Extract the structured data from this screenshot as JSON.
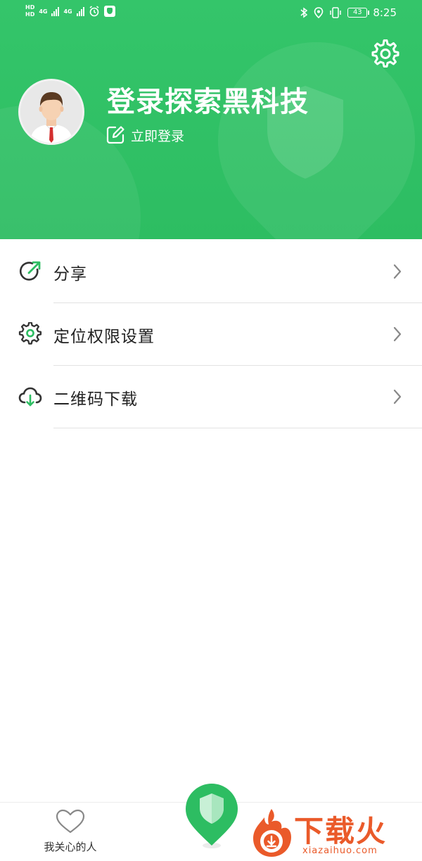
{
  "status_bar": {
    "hd_top": "HD",
    "hd_bottom": "HD",
    "sim1": "4G",
    "sim2": "4G",
    "battery": "43",
    "time": "8:25"
  },
  "header": {
    "title": "登录探索黑科技",
    "login_label": "立即登录",
    "background_color": "#2dbd62"
  },
  "menu": {
    "items": [
      {
        "label": "分享",
        "icon": "share-icon"
      },
      {
        "label": "定位权限设置",
        "icon": "gear-icon"
      },
      {
        "label": "二维码下载",
        "icon": "cloud-download-icon"
      }
    ]
  },
  "tabbar": {
    "care_label": "我关心的人",
    "care_icon": "heart-icon",
    "center_icon": "shield-pin-icon"
  },
  "watermark": {
    "text": "下载火",
    "sub": "xiazaihuo.com"
  },
  "colors": {
    "accent": "#2dbd62",
    "watermark": "#ea5a2a"
  }
}
